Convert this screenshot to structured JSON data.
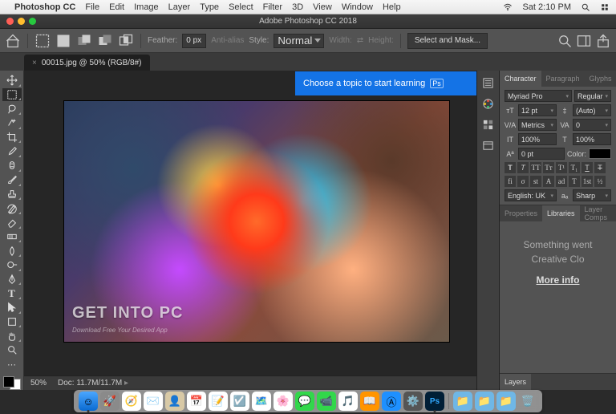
{
  "menubar": {
    "app_name": "Photoshop CC",
    "items": [
      "File",
      "Edit",
      "Image",
      "Layer",
      "Type",
      "Select",
      "Filter",
      "3D",
      "View",
      "Window",
      "Help"
    ],
    "clock": "Sat 2:10 PM"
  },
  "titlebar": {
    "title": "Adobe Photoshop CC 2018"
  },
  "options": {
    "feather_label": "Feather:",
    "feather_value": "0 px",
    "antialias_label": "Anti-alias",
    "style_label": "Style:",
    "style_value": "Normal",
    "width_label": "Width:",
    "height_label": "Height:",
    "select_mask": "Select and Mask..."
  },
  "doc_tab": {
    "label": "00015.jpg @ 50% (RGB/8#)"
  },
  "learn_tip": {
    "text": "Choose a topic to start learning",
    "badge": "Ps"
  },
  "watermark": {
    "main": "GET INTO PC",
    "sub": "Download Free Your Desired App"
  },
  "status": {
    "zoom": "50%",
    "doc": "Doc: 11.7M/11.7M"
  },
  "char_panel": {
    "tabs": [
      "Character",
      "Paragraph",
      "Glyphs"
    ],
    "font": "Myriad Pro",
    "style": "Regular",
    "size": "12 pt",
    "leading": "(Auto)",
    "kerning": "Metrics",
    "tracking": "0",
    "vscale": "100%",
    "hscale": "100%",
    "baseline": "0 pt",
    "color_label": "Color:",
    "lang": "English: UK",
    "aa": "Sharp"
  },
  "props_panel": {
    "tabs": [
      "Properties",
      "Libraries",
      "Layer Comps"
    ]
  },
  "lib_body": {
    "line1": "Something went",
    "line2": "Creative Clo",
    "more": "More info"
  },
  "layers_panel": {
    "tab": "Layers"
  },
  "dock_apps": [
    {
      "name": "finder",
      "bg": "linear-gradient(#4aa6ff,#0a6ad0)",
      "glyph": "☺"
    },
    {
      "name": "launchpad",
      "bg": "#8a8a8a",
      "glyph": "🚀"
    },
    {
      "name": "safari",
      "bg": "#fff",
      "glyph": "🧭"
    },
    {
      "name": "mail",
      "bg": "#fff",
      "glyph": "✉️"
    },
    {
      "name": "contacts",
      "bg": "#d8c9a6",
      "glyph": "👤"
    },
    {
      "name": "calendar",
      "bg": "#fff",
      "glyph": "📅"
    },
    {
      "name": "notes",
      "bg": "#fff",
      "glyph": "📝"
    },
    {
      "name": "reminders",
      "bg": "#fff",
      "glyph": "☑️"
    },
    {
      "name": "maps",
      "bg": "#fff",
      "glyph": "🗺️"
    },
    {
      "name": "photos",
      "bg": "#fff",
      "glyph": "🌸"
    },
    {
      "name": "messages",
      "bg": "#32d74b",
      "glyph": "💬"
    },
    {
      "name": "facetime",
      "bg": "#32d74b",
      "glyph": "📹"
    },
    {
      "name": "itunes",
      "bg": "#fff",
      "glyph": "🎵"
    },
    {
      "name": "ibooks",
      "bg": "#ff9500",
      "glyph": "📖"
    },
    {
      "name": "appstore",
      "bg": "#1e90ff",
      "glyph": "Ⓐ"
    },
    {
      "name": "preferences",
      "bg": "#555",
      "glyph": "⚙️"
    },
    {
      "name": "photoshop",
      "bg": "#001e36",
      "glyph": "Ps"
    }
  ],
  "dock_right": [
    {
      "name": "folder1",
      "bg": "#6fb7e6",
      "glyph": "📁"
    },
    {
      "name": "folder2",
      "bg": "#6fb7e6",
      "glyph": "📁"
    },
    {
      "name": "folder3",
      "bg": "#6fb7e6",
      "glyph": "📁"
    },
    {
      "name": "trash",
      "bg": "transparent",
      "glyph": "🗑️"
    }
  ]
}
